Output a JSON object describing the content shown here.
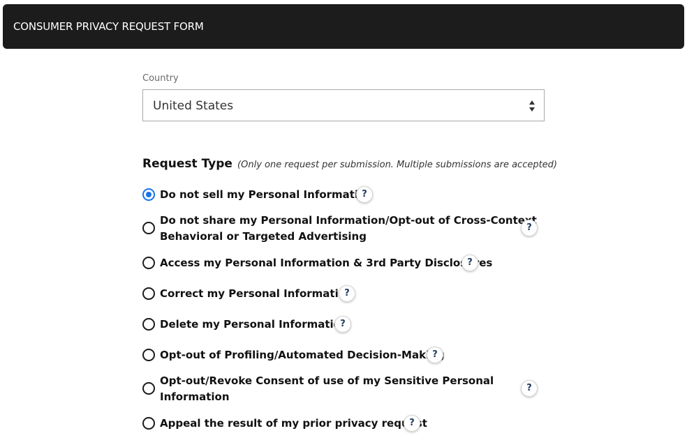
{
  "header": {
    "title": "CONSUMER PRIVACY REQUEST FORM"
  },
  "country": {
    "label": "Country",
    "value": "United States"
  },
  "request_type": {
    "title": "Request Type",
    "note": "(Only one request per submission. Multiple submissions are accepted)",
    "options": [
      {
        "label": "Do not sell my Personal Information",
        "selected": true,
        "help": "?"
      },
      {
        "label_line1": "Do not share my Personal Information/Opt-out of Cross-Context",
        "label_line2": "Behavioral or Targeted Advertising",
        "selected": false,
        "help": "?"
      },
      {
        "label": "Access my Personal Information & 3rd Party Disclosures",
        "selected": false,
        "help": "?"
      },
      {
        "label": "Correct my Personal Information",
        "selected": false,
        "help": "?"
      },
      {
        "label": "Delete my Personal Information",
        "selected": false,
        "help": "?"
      },
      {
        "label": "Opt-out of Profiling/Automated Decision-Making",
        "selected": false,
        "help": "?"
      },
      {
        "label_line1": "Opt-out/Revoke Consent of use of my Sensitive Personal",
        "label_line2": "Information",
        "selected": false,
        "help": "?"
      },
      {
        "label": "Appeal the result of my prior privacy request",
        "selected": false,
        "help": "?"
      }
    ]
  },
  "colors": {
    "header_bg": "#1c1c1c",
    "accent": "#1a73e8"
  },
  "icons": [
    "select-arrows-icon",
    "help-icon",
    "radio-selected-icon",
    "radio-unselected-icon"
  ]
}
